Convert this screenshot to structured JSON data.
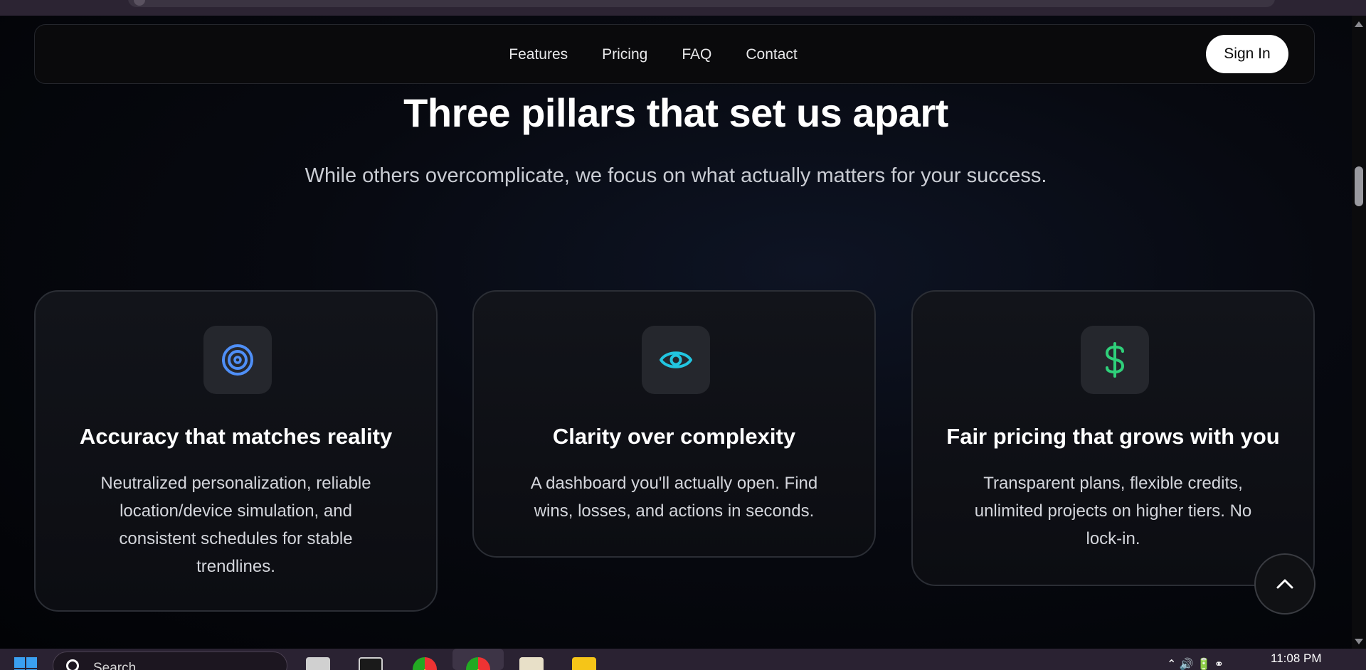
{
  "nav": {
    "links": [
      "Features",
      "Pricing",
      "FAQ",
      "Contact"
    ],
    "signin_label": "Sign In"
  },
  "hero": {
    "title": "Three pillars that set us apart",
    "subtitle": "While others overcomplicate, we focus on what actually matters for your success."
  },
  "cards": [
    {
      "icon": "target-icon",
      "icon_color": "#4f8ff7",
      "title": "Accuracy that matches reality",
      "text": "Neutralized personalization, reliable location/device simulation, and consistent schedules for stable trendlines."
    },
    {
      "icon": "eye-icon",
      "icon_color": "#22c5e0",
      "title": "Clarity over complexity",
      "text": "A dashboard you'll actually open. Find wins, losses, and actions in seconds."
    },
    {
      "icon": "dollar-icon",
      "icon_color": "#2fd07a",
      "title": "Fair pricing that grows with you",
      "text": "Transparent plans, flexible credits, unlimited projects on higher tiers. No lock-in."
    }
  ],
  "taskbar": {
    "search_placeholder": "Search",
    "time": "11:08 PM"
  },
  "colors": {
    "background": "#05060a",
    "card_border": "#2b2e35",
    "signin_bg": "#ffffff"
  }
}
